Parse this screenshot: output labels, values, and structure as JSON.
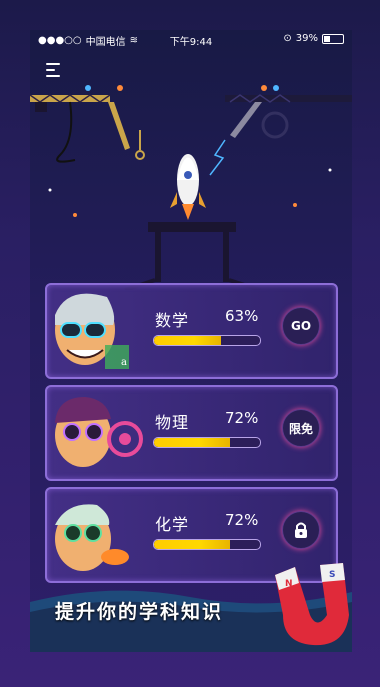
{
  "status_bar": {
    "carrier": "中国电信",
    "time": "下午9:44",
    "battery": "39%"
  },
  "subjects": [
    {
      "name": "数学",
      "percent_text": "63%",
      "progress": 0.63,
      "action": "GO"
    },
    {
      "name": "物理",
      "percent_text": "72%",
      "progress": 0.72,
      "action": "限免"
    },
    {
      "name": "化学",
      "percent_text": "72%",
      "progress": 0.72,
      "action": "lock-icon"
    }
  ],
  "tagline": "提升你的学科知识",
  "colors": {
    "background": "#2a1f63",
    "card_border": "#8d6ed8",
    "progress_fill": "#ffcc00",
    "accent_pink": "#e84b9a",
    "magnet_red": "#e02a3a"
  }
}
